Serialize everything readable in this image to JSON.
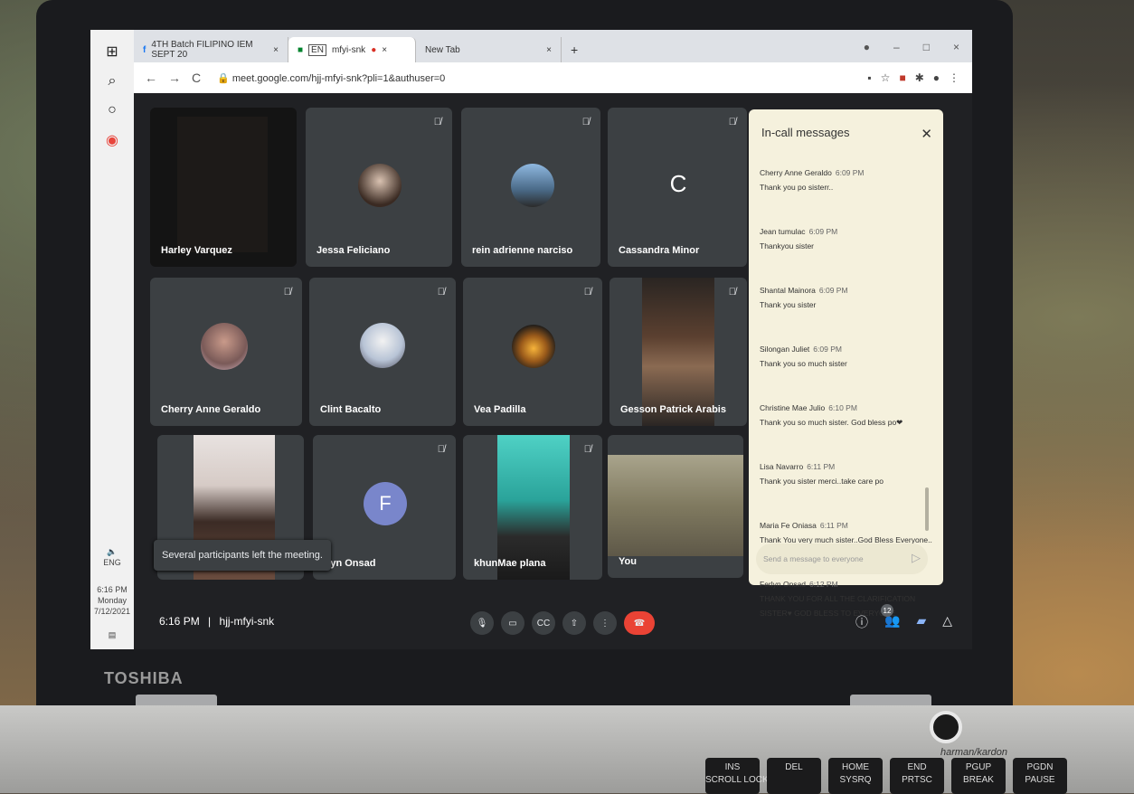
{
  "laptop": {
    "brand": "TOSHIBA",
    "speaker_brand": "harman/kardon",
    "keys": [
      "INS\nSCROLL LOCK",
      "DEL",
      "HOME\nSYSRQ",
      "END\nPRTSC",
      "PGUP\nBREAK",
      "PGDN\nPAUSE"
    ]
  },
  "taskbar": {
    "lang": "ENG",
    "time": "6:16 PM",
    "day": "Monday",
    "date": "7/12/2021"
  },
  "browser": {
    "tabs": [
      {
        "label": "4TH Batch FILIPINO IEM SEPT 20"
      },
      {
        "label": "EN"
      },
      {
        "label": "mfyi-snk"
      },
      {
        "label": "New Tab"
      }
    ],
    "url": "meet.google.com/hjj-mfyi-snk?pli=1&authuser=0"
  },
  "participants": [
    {
      "name": "Harley Varquez"
    },
    {
      "name": "Jessa Feliciano"
    },
    {
      "name": "rein adrienne narciso"
    },
    {
      "name": "Cassandra Minor",
      "initial": "C"
    },
    {
      "name": "Cherry Anne Geraldo"
    },
    {
      "name": "Clint Bacalto"
    },
    {
      "name": "Vea Padilla"
    },
    {
      "name": "Gesson Patrick Arabis"
    },
    {
      "name": ""
    },
    {
      "name": "rlyn Onsad",
      "initial": "F"
    },
    {
      "name": "khunMae plana"
    },
    {
      "name": "You"
    }
  ],
  "toast": "Several participants left the meeting.",
  "meeting": {
    "time": "6:16 PM",
    "separator": "|",
    "code": "hjj-mfyi-snk",
    "people_count": "12"
  },
  "chat": {
    "title": "In-call messages",
    "messages": [
      {
        "from": "Cherry Anne Geraldo",
        "time": "6:09 PM",
        "text": "Thank you po sisterr.."
      },
      {
        "from": "Jean tumulac",
        "time": "6:09 PM",
        "text": "Thankyou sister"
      },
      {
        "from": "Shantal Mainora",
        "time": "6:09 PM",
        "text": "Thank you sister"
      },
      {
        "from": "Silongan Juliet",
        "time": "6:09 PM",
        "text": "Thank you so much sister"
      },
      {
        "from": "Christine Mae Julio",
        "time": "6:10 PM",
        "text": "Thank you so much sister. God bless po❤"
      },
      {
        "from": "Lisa Navarro",
        "time": "6:11 PM",
        "text": "Thank you sister merci..take care po"
      },
      {
        "from": "Maria Fe Oniasa",
        "time": "6:11 PM",
        "text": "Thank You very much sister..God Bless Everyone.."
      },
      {
        "from": "Ferlyn Onsad",
        "time": "6:12 PM",
        "text": "THANK YOU FOR ALL THE CLARIFICATION SISTER♥ GOD BLESS TO EVERYONE"
      }
    ],
    "placeholder": "Send a message to everyone"
  }
}
